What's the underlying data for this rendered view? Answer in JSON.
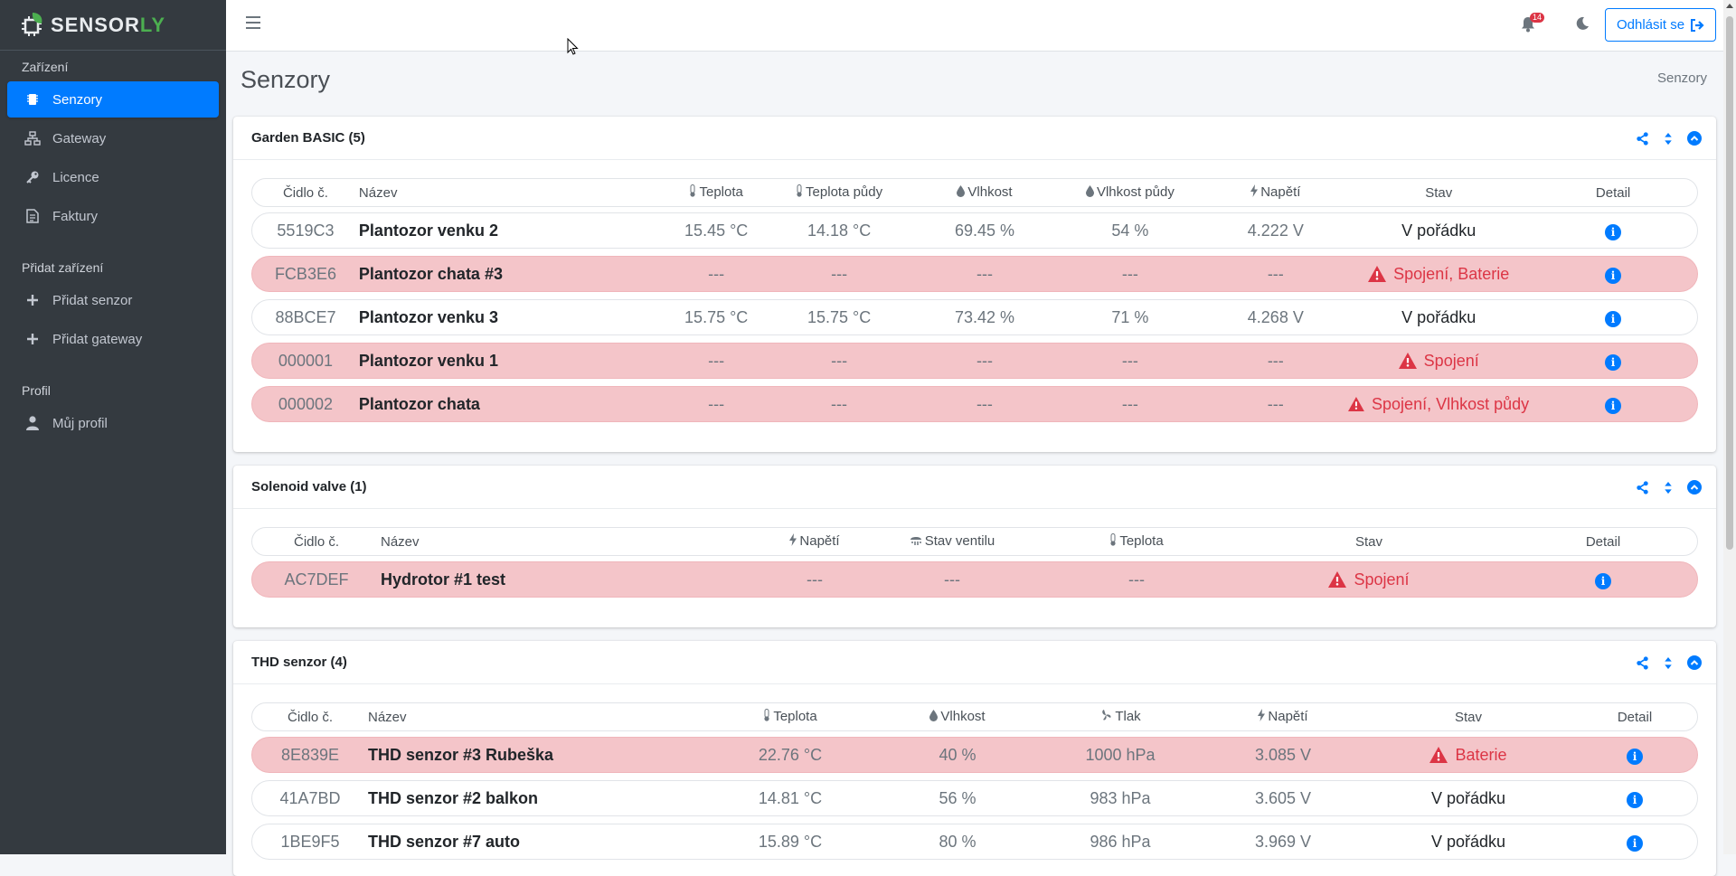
{
  "brand": {
    "name_main": "SENSOR",
    "name_accent": "LY"
  },
  "sidebar": {
    "sections": [
      {
        "header": "Zařízení",
        "items": [
          {
            "label": "Senzory",
            "icon": "chip-icon",
            "active": true
          },
          {
            "label": "Gateway",
            "icon": "network-icon"
          },
          {
            "label": "Licence",
            "icon": "key-icon"
          },
          {
            "label": "Faktury",
            "icon": "invoice-icon"
          }
        ]
      },
      {
        "header": "Přidat zařízení",
        "items": [
          {
            "label": "Přidat senzor",
            "icon": "plus-icon"
          },
          {
            "label": "Přidat gateway",
            "icon": "plus-icon"
          }
        ]
      },
      {
        "header": "Profil",
        "items": [
          {
            "label": "Můj profil",
            "icon": "user-icon"
          }
        ]
      }
    ]
  },
  "topbar": {
    "notifications": "14",
    "logout_label": "Odhlásit se"
  },
  "page": {
    "title": "Senzory",
    "breadcrumb": "Senzory"
  },
  "colors": {
    "primary": "#007bff",
    "danger": "#dc3545",
    "error_row": "#f4c5c9",
    "sidebar": "#343a40"
  },
  "garden": {
    "title": "Garden BASIC (5)",
    "headers": {
      "id": "Čidlo č.",
      "name": "Název",
      "temp": "Teplota",
      "soil_temp": "Teplota půdy",
      "hum": "Vlhkost",
      "soil_hum": "Vlhkost půdy",
      "volt": "Napětí",
      "state": "Stav",
      "detail": "Detail"
    },
    "rows": [
      {
        "id": "5519C3",
        "name": "Plantozor venku 2",
        "temp": "15.45 °C",
        "soil_temp": "14.18 °C",
        "hum": "69.45 %",
        "soil_hum": "54 %",
        "volt": "4.222 V",
        "state": "V pořádku",
        "error": false
      },
      {
        "id": "FCB3E6",
        "name": "Plantozor chata #3",
        "temp": "---",
        "soil_temp": "---",
        "hum": "---",
        "soil_hum": "---",
        "volt": "---",
        "state": "Spojení, Baterie",
        "error": true
      },
      {
        "id": "88BCE7",
        "name": "Plantozor venku 3",
        "temp": "15.75 °C",
        "soil_temp": "15.75 °C",
        "hum": "73.42 %",
        "soil_hum": "71 %",
        "volt": "4.268 V",
        "state": "V pořádku",
        "error": false
      },
      {
        "id": "000001",
        "name": "Plantozor venku 1",
        "temp": "---",
        "soil_temp": "---",
        "hum": "---",
        "soil_hum": "---",
        "volt": "---",
        "state": "Spojení",
        "error": true
      },
      {
        "id": "000002",
        "name": "Plantozor chata",
        "temp": "---",
        "soil_temp": "---",
        "hum": "---",
        "soil_hum": "---",
        "volt": "---",
        "state": "Spojení, Vlhkost půdy",
        "error": true
      }
    ]
  },
  "valve": {
    "title": "Solenoid valve (1)",
    "headers": {
      "id": "Čidlo č.",
      "name": "Název",
      "volt": "Napětí",
      "valve_state": "Stav ventilu",
      "temp": "Teplota",
      "state": "Stav",
      "detail": "Detail"
    },
    "rows": [
      {
        "id": "AC7DEF",
        "name": "Hydrotor #1 test",
        "volt": "---",
        "valve_state": "---",
        "temp": "---",
        "state": "Spojení",
        "error": true
      }
    ]
  },
  "thd": {
    "title": "THD senzor (4)",
    "headers": {
      "id": "Čidlo č.",
      "name": "Název",
      "temp": "Teplota",
      "hum": "Vlhkost",
      "press": "Tlak",
      "volt": "Napětí",
      "state": "Stav",
      "detail": "Detail"
    },
    "rows": [
      {
        "id": "8E839E",
        "name": "THD senzor #3 Rubeška",
        "temp": "22.76 °C",
        "hum": "40 %",
        "press": "1000 hPa",
        "volt": "3.085 V",
        "state": "Baterie",
        "error": true
      },
      {
        "id": "41A7BD",
        "name": "THD senzor #2 balkon",
        "temp": "14.81 °C",
        "hum": "56 %",
        "press": "983 hPa",
        "volt": "3.605 V",
        "state": "V pořádku",
        "error": false
      },
      {
        "id": "1BE9F5",
        "name": "THD senzor #7 auto",
        "temp": "15.89 °C",
        "hum": "80 %",
        "press": "986 hPa",
        "volt": "3.969 V",
        "state": "V pořádku",
        "error": false
      }
    ]
  }
}
